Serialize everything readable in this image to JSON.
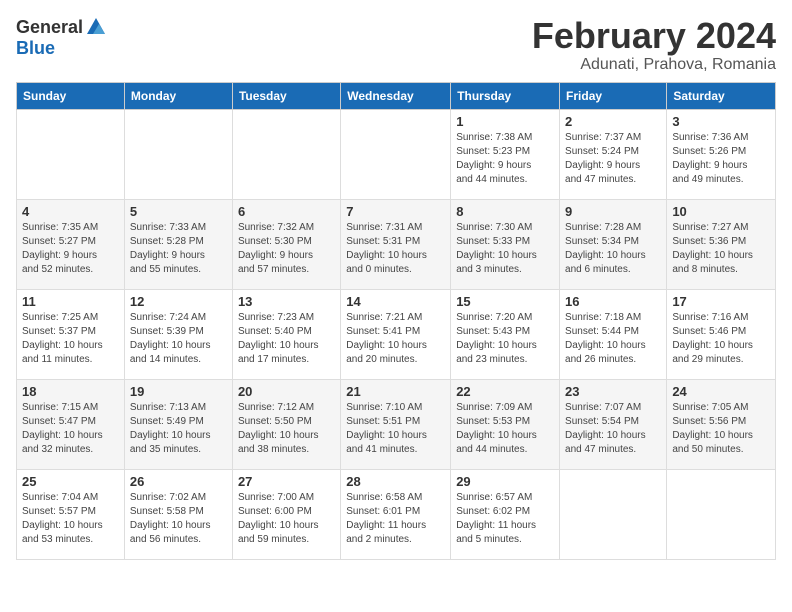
{
  "header": {
    "logo_general": "General",
    "logo_blue": "Blue",
    "month_title": "February 2024",
    "location": "Adunati, Prahova, Romania"
  },
  "days_of_week": [
    "Sunday",
    "Monday",
    "Tuesday",
    "Wednesday",
    "Thursday",
    "Friday",
    "Saturday"
  ],
  "weeks": [
    [
      {
        "day": "",
        "info": ""
      },
      {
        "day": "",
        "info": ""
      },
      {
        "day": "",
        "info": ""
      },
      {
        "day": "",
        "info": ""
      },
      {
        "day": "1",
        "info": "Sunrise: 7:38 AM\nSunset: 5:23 PM\nDaylight: 9 hours\nand 44 minutes."
      },
      {
        "day": "2",
        "info": "Sunrise: 7:37 AM\nSunset: 5:24 PM\nDaylight: 9 hours\nand 47 minutes."
      },
      {
        "day": "3",
        "info": "Sunrise: 7:36 AM\nSunset: 5:26 PM\nDaylight: 9 hours\nand 49 minutes."
      }
    ],
    [
      {
        "day": "4",
        "info": "Sunrise: 7:35 AM\nSunset: 5:27 PM\nDaylight: 9 hours\nand 52 minutes."
      },
      {
        "day": "5",
        "info": "Sunrise: 7:33 AM\nSunset: 5:28 PM\nDaylight: 9 hours\nand 55 minutes."
      },
      {
        "day": "6",
        "info": "Sunrise: 7:32 AM\nSunset: 5:30 PM\nDaylight: 9 hours\nand 57 minutes."
      },
      {
        "day": "7",
        "info": "Sunrise: 7:31 AM\nSunset: 5:31 PM\nDaylight: 10 hours\nand 0 minutes."
      },
      {
        "day": "8",
        "info": "Sunrise: 7:30 AM\nSunset: 5:33 PM\nDaylight: 10 hours\nand 3 minutes."
      },
      {
        "day": "9",
        "info": "Sunrise: 7:28 AM\nSunset: 5:34 PM\nDaylight: 10 hours\nand 6 minutes."
      },
      {
        "day": "10",
        "info": "Sunrise: 7:27 AM\nSunset: 5:36 PM\nDaylight: 10 hours\nand 8 minutes."
      }
    ],
    [
      {
        "day": "11",
        "info": "Sunrise: 7:25 AM\nSunset: 5:37 PM\nDaylight: 10 hours\nand 11 minutes."
      },
      {
        "day": "12",
        "info": "Sunrise: 7:24 AM\nSunset: 5:39 PM\nDaylight: 10 hours\nand 14 minutes."
      },
      {
        "day": "13",
        "info": "Sunrise: 7:23 AM\nSunset: 5:40 PM\nDaylight: 10 hours\nand 17 minutes."
      },
      {
        "day": "14",
        "info": "Sunrise: 7:21 AM\nSunset: 5:41 PM\nDaylight: 10 hours\nand 20 minutes."
      },
      {
        "day": "15",
        "info": "Sunrise: 7:20 AM\nSunset: 5:43 PM\nDaylight: 10 hours\nand 23 minutes."
      },
      {
        "day": "16",
        "info": "Sunrise: 7:18 AM\nSunset: 5:44 PM\nDaylight: 10 hours\nand 26 minutes."
      },
      {
        "day": "17",
        "info": "Sunrise: 7:16 AM\nSunset: 5:46 PM\nDaylight: 10 hours\nand 29 minutes."
      }
    ],
    [
      {
        "day": "18",
        "info": "Sunrise: 7:15 AM\nSunset: 5:47 PM\nDaylight: 10 hours\nand 32 minutes."
      },
      {
        "day": "19",
        "info": "Sunrise: 7:13 AM\nSunset: 5:49 PM\nDaylight: 10 hours\nand 35 minutes."
      },
      {
        "day": "20",
        "info": "Sunrise: 7:12 AM\nSunset: 5:50 PM\nDaylight: 10 hours\nand 38 minutes."
      },
      {
        "day": "21",
        "info": "Sunrise: 7:10 AM\nSunset: 5:51 PM\nDaylight: 10 hours\nand 41 minutes."
      },
      {
        "day": "22",
        "info": "Sunrise: 7:09 AM\nSunset: 5:53 PM\nDaylight: 10 hours\nand 44 minutes."
      },
      {
        "day": "23",
        "info": "Sunrise: 7:07 AM\nSunset: 5:54 PM\nDaylight: 10 hours\nand 47 minutes."
      },
      {
        "day": "24",
        "info": "Sunrise: 7:05 AM\nSunset: 5:56 PM\nDaylight: 10 hours\nand 50 minutes."
      }
    ],
    [
      {
        "day": "25",
        "info": "Sunrise: 7:04 AM\nSunset: 5:57 PM\nDaylight: 10 hours\nand 53 minutes."
      },
      {
        "day": "26",
        "info": "Sunrise: 7:02 AM\nSunset: 5:58 PM\nDaylight: 10 hours\nand 56 minutes."
      },
      {
        "day": "27",
        "info": "Sunrise: 7:00 AM\nSunset: 6:00 PM\nDaylight: 10 hours\nand 59 minutes."
      },
      {
        "day": "28",
        "info": "Sunrise: 6:58 AM\nSunset: 6:01 PM\nDaylight: 11 hours\nand 2 minutes."
      },
      {
        "day": "29",
        "info": "Sunrise: 6:57 AM\nSunset: 6:02 PM\nDaylight: 11 hours\nand 5 minutes."
      },
      {
        "day": "",
        "info": ""
      },
      {
        "day": "",
        "info": ""
      }
    ]
  ]
}
